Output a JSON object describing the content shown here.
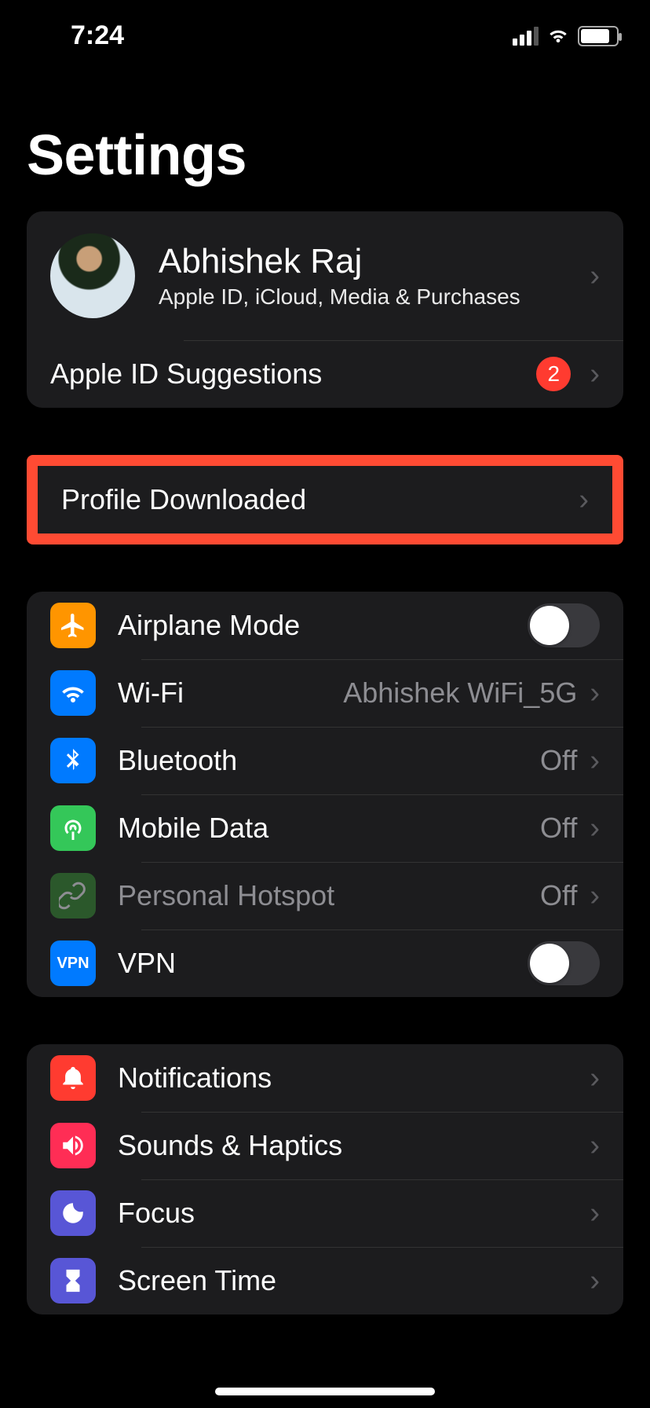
{
  "status": {
    "time": "7:24"
  },
  "title": "Settings",
  "profile": {
    "name": "Abhishek Raj",
    "subtitle": "Apple ID, iCloud, Media & Purchases",
    "suggestions_label": "Apple ID Suggestions",
    "suggestions_count": "2"
  },
  "profile_downloaded": {
    "label": "Profile Downloaded"
  },
  "connectivity": {
    "airplane": {
      "label": "Airplane Mode"
    },
    "wifi": {
      "label": "Wi-Fi",
      "value": "Abhishek WiFi_5G"
    },
    "bluetooth": {
      "label": "Bluetooth",
      "value": "Off"
    },
    "mobile_data": {
      "label": "Mobile Data",
      "value": "Off"
    },
    "hotspot": {
      "label": "Personal Hotspot",
      "value": "Off"
    },
    "vpn": {
      "label": "VPN"
    }
  },
  "general": {
    "notifications": {
      "label": "Notifications"
    },
    "sounds": {
      "label": "Sounds & Haptics"
    },
    "focus": {
      "label": "Focus"
    },
    "screen_time": {
      "label": "Screen Time"
    }
  }
}
